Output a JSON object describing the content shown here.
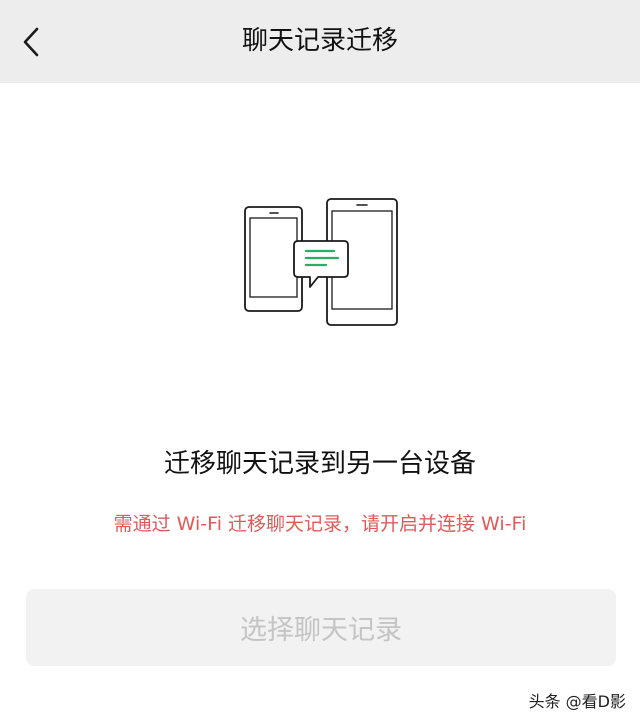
{
  "header": {
    "title": "聊天记录迁移",
    "back_icon": "chevron-left-icon"
  },
  "main": {
    "illustration_icon": "phones-transfer-icon",
    "accent_color": "#2aae67",
    "heading": "迁移聊天记录到另一台设备",
    "notice": "需通过 Wi-Fi 迁移聊天记录，请开启并连接 Wi-Fi",
    "notice_color": "#e05a5a",
    "select_button_label": "选择聊天记录"
  },
  "watermark": "头条 @看D影"
}
